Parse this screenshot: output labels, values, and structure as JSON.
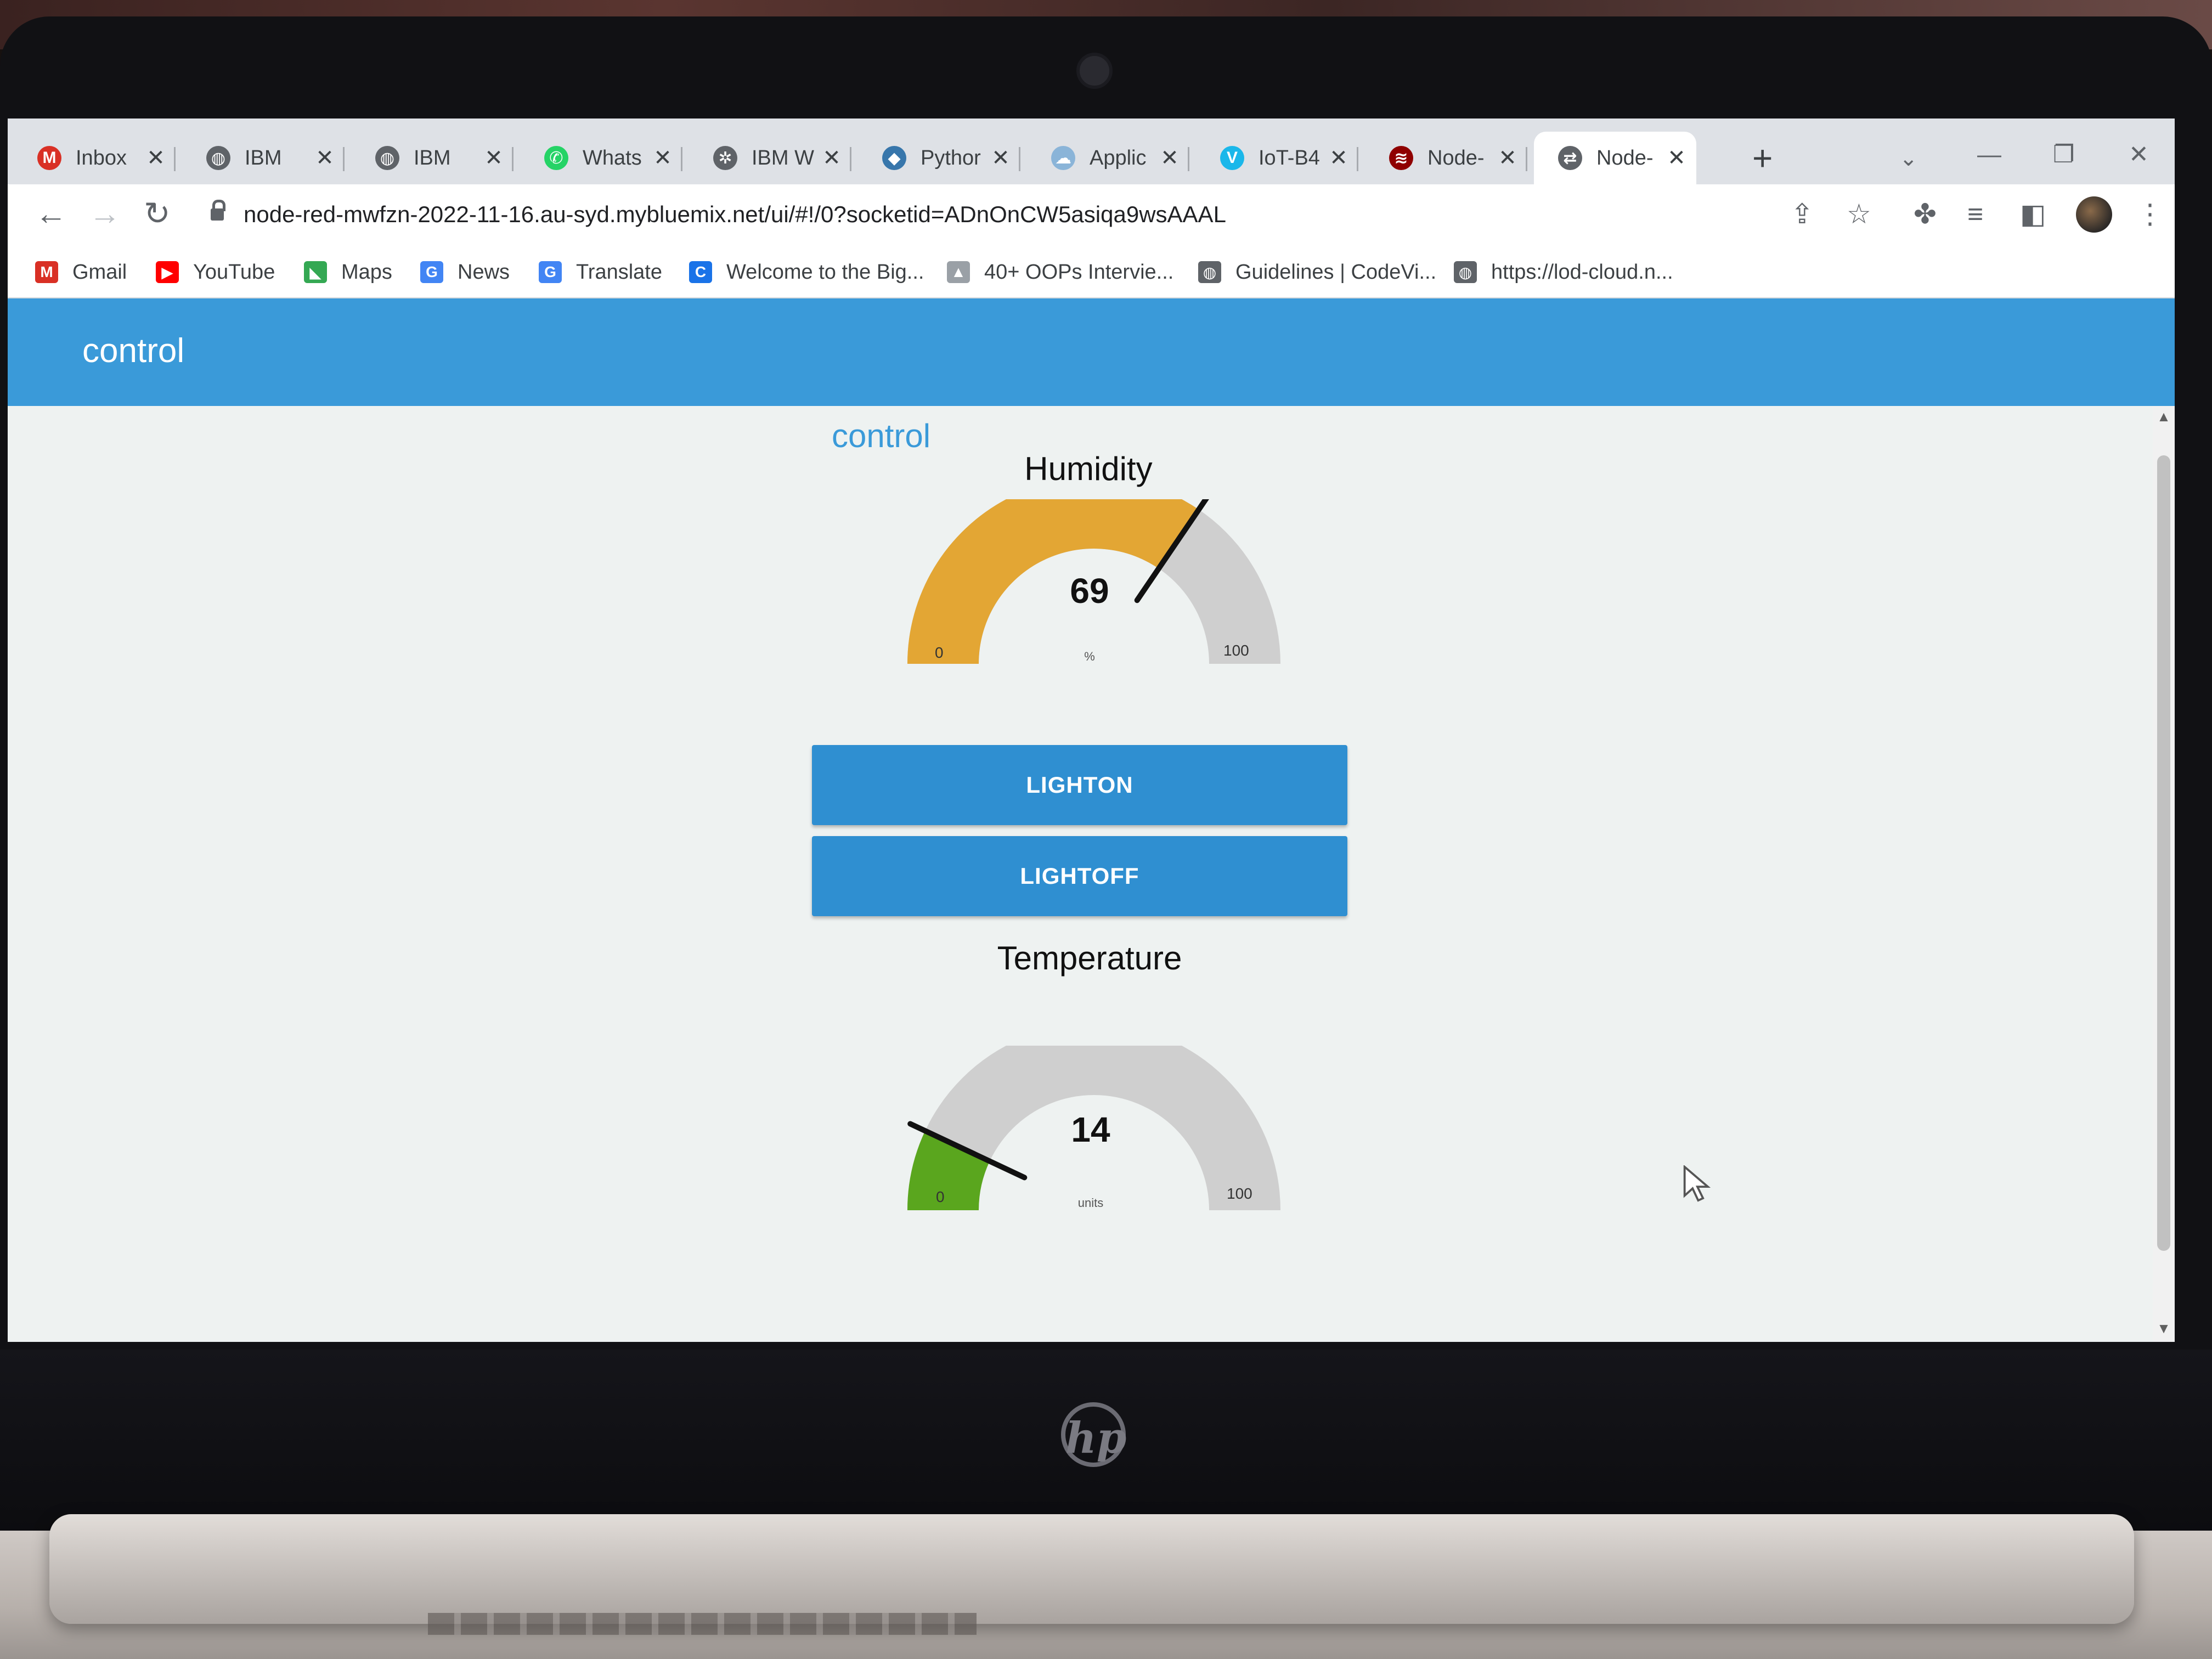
{
  "browser": {
    "tabs": [
      {
        "title": "Inbox",
        "icon": "gmail-icon",
        "color": "#d93025",
        "glyph": "M"
      },
      {
        "title": "IBM",
        "icon": "globe-icon",
        "color": "#5f6368",
        "glyph": "◍"
      },
      {
        "title": "IBM",
        "icon": "globe-icon",
        "color": "#5f6368",
        "glyph": "◍"
      },
      {
        "title": "Whats",
        "icon": "whatsapp-icon",
        "color": "#25d366",
        "glyph": "✆"
      },
      {
        "title": "IBM W",
        "icon": "ibm-watson-icon",
        "color": "#5f6368",
        "glyph": "✲"
      },
      {
        "title": "Pythor",
        "icon": "python-icon",
        "color": "#3776ab",
        "glyph": "◆"
      },
      {
        "title": "Applic",
        "icon": "cloud-icon",
        "color": "#8ab4d8",
        "glyph": "☁"
      },
      {
        "title": "IoT-B4",
        "icon": "vimeo-icon",
        "color": "#1ab7ea",
        "glyph": "V"
      },
      {
        "title": "Node-",
        "icon": "node-red-icon",
        "color": "#8f0000",
        "glyph": "≋"
      },
      {
        "title": "Node-",
        "icon": "node-red-flow-icon",
        "color": "#5f6368",
        "glyph": "⇄",
        "active": true
      }
    ],
    "address": "node-red-mwfzn-2022-11-16.au-syd.mybluemix.net/ui/#!/0?socketid=ADnOnCW5asiqa9wsAAAL",
    "bookmarks": [
      {
        "label": "Gmail",
        "icon": "gmail-icon",
        "color": "#d93025",
        "glyph": "M"
      },
      {
        "label": "YouTube",
        "icon": "youtube-icon",
        "color": "#ff0000",
        "glyph": "▶"
      },
      {
        "label": "Maps",
        "icon": "maps-icon",
        "color": "#34a853",
        "glyph": "◣"
      },
      {
        "label": "News",
        "icon": "news-icon",
        "color": "#4285f4",
        "glyph": "G"
      },
      {
        "label": "Translate",
        "icon": "translate-icon",
        "color": "#4285f4",
        "glyph": "G"
      },
      {
        "label": "Welcome to the Big...",
        "icon": "c-logo-icon",
        "color": "#1a73e8",
        "glyph": "C"
      },
      {
        "label": "40+ OOPs Intervie...",
        "icon": "chart-icon",
        "color": "#9aa0a6",
        "glyph": "▲"
      },
      {
        "label": "Guidelines | CodeVi...",
        "icon": "globe-icon",
        "color": "#5f6368",
        "glyph": "◍"
      },
      {
        "label": "https://lod-cloud.n...",
        "icon": "globe-icon",
        "color": "#5f6368",
        "glyph": "◍"
      }
    ]
  },
  "dashboard": {
    "header_title": "control",
    "group_title": "control",
    "accent_color": "#3a9ad9",
    "humidity": {
      "title": "Humidity",
      "value": 69,
      "min": 0,
      "max": 100,
      "units": "%",
      "color": "#e3a634",
      "track_color": "#cfcfcf"
    },
    "buttons": {
      "light_on": "LIGHTON",
      "light_off": "LIGHTOFF"
    },
    "temperature": {
      "title": "Temperature",
      "value": 14,
      "min": 0,
      "max": 100,
      "units": "units",
      "color": "#5aa61e",
      "track_color": "#cfcfcf"
    }
  }
}
